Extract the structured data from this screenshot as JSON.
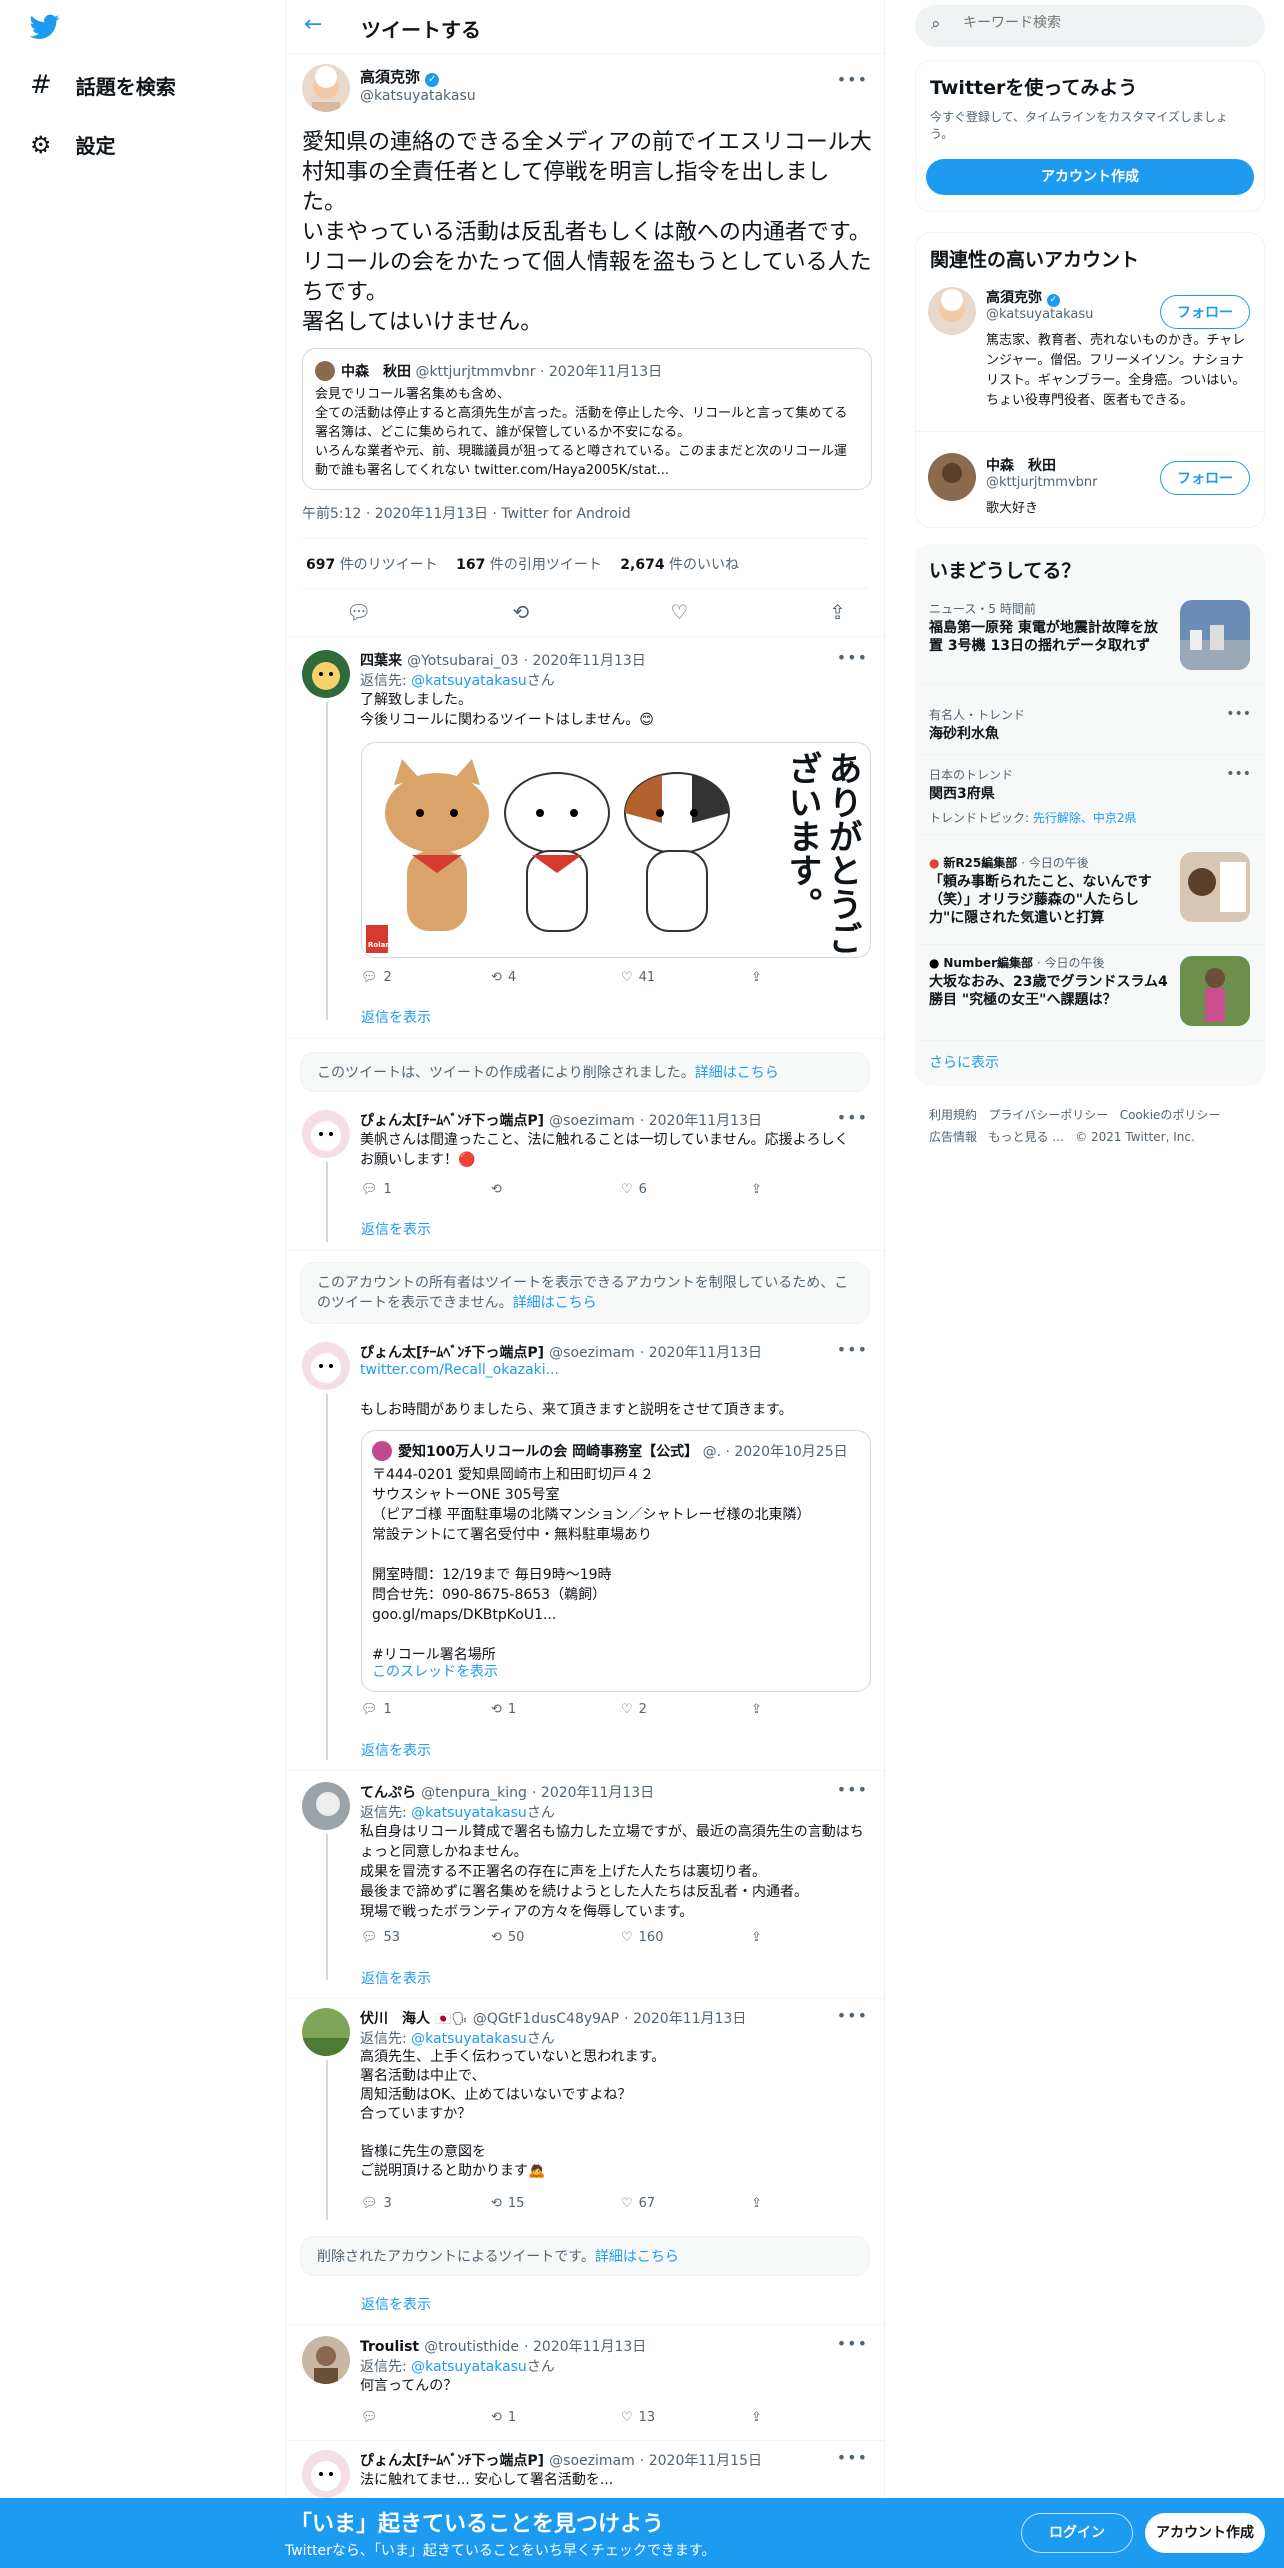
{
  "nav": {
    "explore": "話題を検索",
    "settings": "設定"
  },
  "header": {
    "title": "ツイートする"
  },
  "main_tweet": {
    "name": "高須克弥",
    "handle": "@katsuyatakasu",
    "text": "愛知県の連絡のできる全メディアの前でイエスリコール大村知事の全責任者として停戦を明言し指令を出しました。\nいまやっている活動は反乱者もしくは敵への内通者です。リコールの会をかたって個人情報を盗もうとしている人たちです。\n署名してはいけません。",
    "quote": {
      "name": "中森　秋田",
      "handle": "@kttjurjtmmvbnr",
      "date": "· 2020年11月13日",
      "text": "会見でリコール署名集めも含め、\n全ての活動は停止すると高須先生が言った。活動を停止した今、リコールと言って集めてる署名簿は、どこに集められて、誰が保管しているか不安になる。\nいろんな業者や元、前、現職議員が狙ってると噂されている。このままだと次のリコール運動で誰も署名してくれない twitter.com/Haya2005K/stat..."
    },
    "meta": "午前5:12 · 2020年11月13日 · Twitter for Android",
    "stats": {
      "retweets": "697",
      "retweets_label": "件のリツイート",
      "quotes": "167",
      "quotes_label": "件の引用ツイート",
      "likes": "2,674",
      "likes_label": "件のいいね"
    }
  },
  "replies": [
    {
      "name": "四葉来",
      "handle": "@Yotsubarai_03",
      "date": "· 2020年11月13日",
      "reply_to_label": "返信先:",
      "reply_to": "@katsuyatakasu",
      "reply_suffix": "さん",
      "text": "了解致しました。\n今後リコールに関わるツイートはしません。😊",
      "image_text": "ありがとうございます。",
      "image_badge": "Roland",
      "counts": [
        "2",
        "4",
        "41"
      ]
    },
    {
      "name": "ぴょん太[ﾁｰﾑﾍﾞﾝﾁ下っ端点P]",
      "handle": "@soezimam",
      "date": "· 2020年11月13日",
      "text": "美帆さんは間違ったこと、法に触れることは一切していません。応援よろしくお願いします！🔴",
      "counts": [
        "1",
        "",
        "6"
      ]
    },
    {
      "name": "ぴょん太[ﾁｰﾑﾍﾞﾝﾁ下っ端点P]",
      "handle": "@soezimam",
      "date": "· 2020年11月13日",
      "link": "twitter.com/Recall_okazaki...",
      "text": "もしお時間がありましたら、来て頂きますと説明をさせて頂きます。",
      "quote": {
        "name": "愛知100万人リコールの会 岡崎事務室【公式】",
        "handle": "@.",
        "date": "· 2020年10月25日",
        "text": "〒444-0201 愛知県岡崎市上和田町切戸４２\nサウスシャトーONE 305号室\n（ピアゴ様 平面駐車場の北隣マンション／シャトレーゼ様の北東隣）\n常設テントにて署名受付中・無料駐車場あり\n\n開室時間：12/19まで 毎日9時〜19時\n問合せ先：090-8675-8653（鵜飼）\ngoo.gl/maps/DKBtpKoU1...\n\n#リコール署名場所",
        "thread": "このスレッドを表示"
      },
      "counts": [
        "1",
        "1",
        "2"
      ]
    },
    {
      "name": "てんぷら",
      "handle": "@tenpura_king",
      "date": "· 2020年11月13日",
      "reply_to_label": "返信先:",
      "reply_to": "@katsuyatakasu",
      "reply_suffix": "さん",
      "text": "私自身はリコール賛成で署名も協力した立場ですが、最近の高須先生の言動はちょっと同意しかねません。\n成果を冒涜する不正署名の存在に声を上げた人たちは裏切り者。\n最後まで諦めずに署名集めを続けようとした人たちは反乱者・内通者。\n現場で戦ったボランティアの方々を侮辱しています。",
      "counts": [
        "53",
        "50",
        "160"
      ]
    },
    {
      "name": "伏川　海人",
      "flags": "🇯🇵🗣",
      "handle": "@QGtF1dusC48y9AP",
      "date": "· 2020年11月13日",
      "reply_to_label": "返信先:",
      "reply_to": "@katsuyatakasu",
      "reply_suffix": "さん",
      "text": "高須先生、上手く伝わっていないと思われます。\n署名活動は中止で、\n周知活動はOK、止めてはいないですよね？\n合っていますか？\n\n皆様に先生の意図を\nご説明頂けると助かります🙇",
      "counts": [
        "3",
        "15",
        "67"
      ]
    },
    {
      "name": "Troulist",
      "handle": "@troutisthide",
      "date": "· 2020年11月13日",
      "reply_to_label": "返信先:",
      "reply_to": "@katsuyatakasu",
      "reply_suffix": "さん",
      "text": "何言ってんの？",
      "counts": [
        "",
        "1",
        "13"
      ]
    },
    {
      "name": "ぴょん太[ﾁｰﾑﾍﾞﾝﾁ下っ端点P]",
      "handle": "@soezimam",
      "date": "· 2020年11月15日",
      "text": "法に触れてませ... 安心して署名活動を..."
    }
  ],
  "notices": {
    "deleted_by_author": "このツイートは、ツイートの作成者により削除されました。",
    "detail": "詳細はこちら",
    "restricted": "このアカウントの所有者はツイートを表示できるアカウントを制限しているため、このツイートを表示できません。",
    "deleted_account": "削除されたアカウントによるツイートです。"
  },
  "show_replies": "返信を表示",
  "search": {
    "placeholder": "キーワード検索"
  },
  "signup": {
    "title": "Twitterを使ってみよう",
    "desc": "今すぐ登録して、タイムラインをカスタマイズしましょう。",
    "button": "アカウント作成"
  },
  "related": {
    "title": "関連性の高いアカウント",
    "follow": "フォロー",
    "accounts": [
      {
        "name": "高須克弥",
        "handle": "@katsuyatakasu",
        "bio": "篤志家、教育者、売れないものかき。チャレンジャー。僧侶。フリーメイソン。ナショナリスト。ギャンブラー。全身癌。ついはい。ちょい役専門役者、医者もできる。"
      },
      {
        "name": "中森　秋田",
        "handle": "@kttjurjtmmvbnr",
        "bio": "歌大好き"
      }
    ]
  },
  "trends": {
    "title": "いまどうしてる？",
    "more": "さらに表示",
    "items": [
      {
        "cat": "ニュース・5 時間前",
        "title": "福島第一原発 東電が地震計故障を放置 3号機 13日の揺れデータ取れず"
      },
      {
        "cat": "有名人・トレンド",
        "title": "海砂利水魚"
      },
      {
        "cat": "日本のトレンド",
        "title": "関西3府県",
        "topic_label": "トレンドトピック:",
        "topic": "先行解除、中京2県"
      },
      {
        "cat": "新R25編集部",
        "cat2": "· 今日の午後",
        "title": "「頼み事断られたこと、ないんです（笑）」オリラジ藤森の\"人たらし力\"に隠された気遣いと打算"
      },
      {
        "cat": "Number編集部",
        "cat2": "· 今日の午後",
        "title": "大坂なおみ、23歳でグランドスラム4勝目 \"究極の女王\"へ課題は？"
      }
    ]
  },
  "footer_links": [
    "利用規約",
    "プライバシーポリシー",
    "Cookieのポリシー",
    "広告情報",
    "もっと見る ...",
    "© 2021 Twitter, Inc."
  ],
  "bottom_bar": {
    "title": "「いま」起きていることを見つけよう",
    "desc": "Twitterなら、「いま」起きていることをいち早くチェックできます。",
    "login": "ログイン",
    "signup": "アカウント作成"
  },
  "colors": {
    "accent": "#1d9bf0",
    "banner": "#1d9bf0"
  }
}
